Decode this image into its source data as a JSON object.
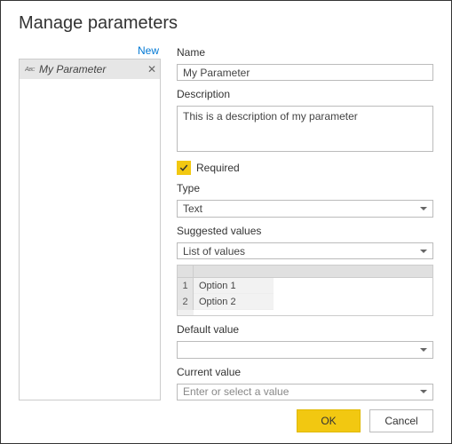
{
  "title": "Manage parameters",
  "sidebar": {
    "new_link": "New",
    "items": [
      {
        "label": "My Parameter"
      }
    ]
  },
  "form": {
    "name_label": "Name",
    "name_value": "My Parameter",
    "description_label": "Description",
    "description_value": "This is a description of my parameter",
    "required_label": "Required",
    "required_checked": true,
    "type_label": "Type",
    "type_value": "Text",
    "suggested_label": "Suggested values",
    "suggested_value": "List of values",
    "values": [
      {
        "index": "1",
        "text": "Option 1"
      },
      {
        "index": "2",
        "text": "Option 2"
      }
    ],
    "default_label": "Default value",
    "default_value": "",
    "current_label": "Current value",
    "current_placeholder": "Enter or select a value"
  },
  "footer": {
    "ok": "OK",
    "cancel": "Cancel"
  }
}
